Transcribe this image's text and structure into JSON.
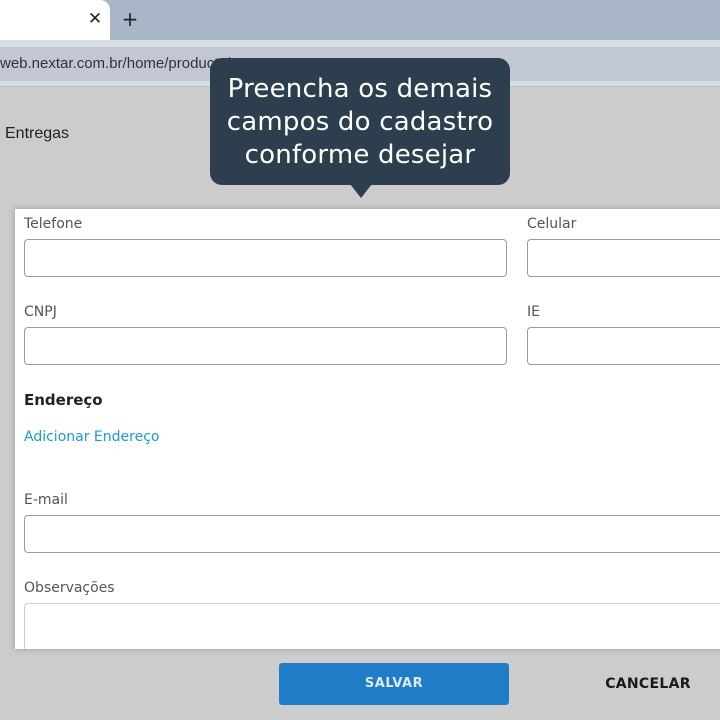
{
  "browser": {
    "tab_close": "✕",
    "new_tab": "+",
    "url": "web.nextar.com.br/home/products/t"
  },
  "page": {
    "nav_label": "Entregas"
  },
  "tooltip": {
    "lines": [
      "Preencha os demais",
      "campos do cadastro",
      "conforme desejar"
    ],
    "color": "#2d3e4e"
  },
  "form": {
    "phone_label": "Telefone",
    "phone_value": "",
    "mobile_label": "Celular",
    "mobile_value": "",
    "cnpj_label": "CNPJ",
    "cnpj_value": "",
    "ie_label": "IE",
    "ie_value": "",
    "address_title": "Endereço",
    "add_address_link": "Adicionar Endereço",
    "email_label": "E-mail",
    "email_value": "",
    "notes_label": "Observações",
    "notes_value": ""
  },
  "actions": {
    "save_label": "SALVAR",
    "cancel_label": "CANCELAR",
    "save_color": "#1f7cc7",
    "link_color": "#1a9ad6"
  }
}
